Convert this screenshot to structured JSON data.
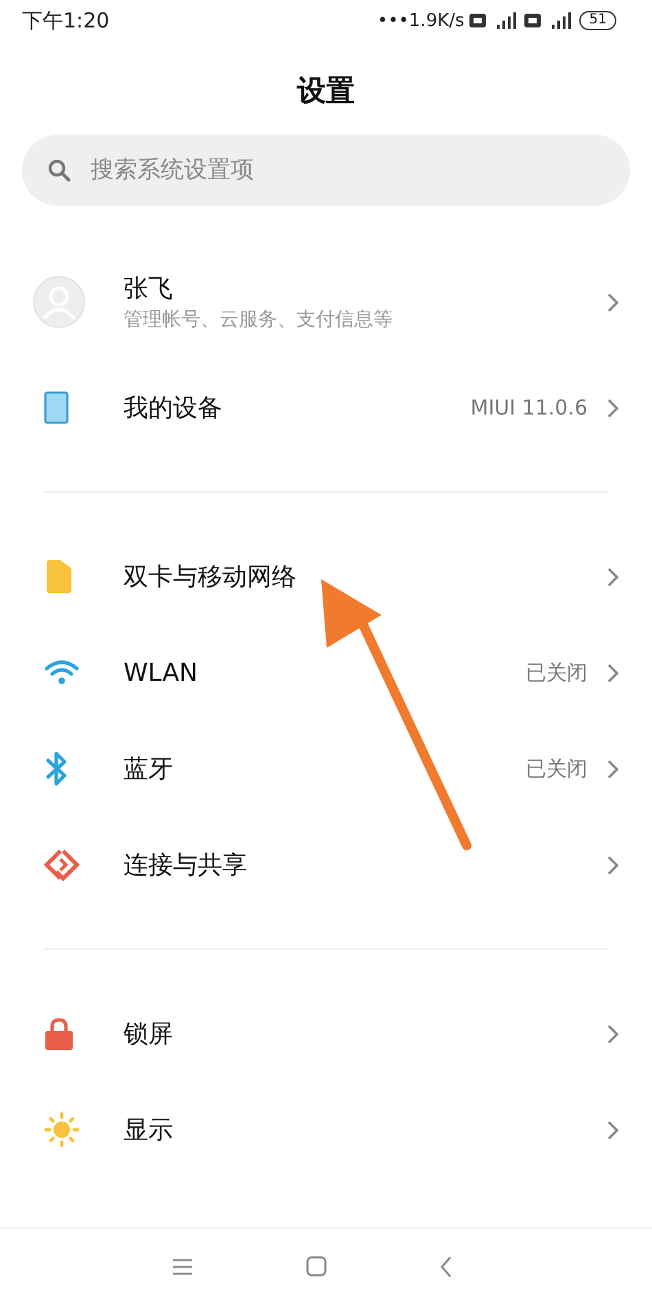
{
  "status_bar": {
    "time": "下午1:20",
    "speed": "•••1.9K/s",
    "battery": "51"
  },
  "title": "设置",
  "search": {
    "placeholder": "搜索系统设置项"
  },
  "sections": [
    {
      "rows": [
        {
          "kind": "profile",
          "label": "张飞",
          "subtitle": "管理帐号、云服务、支付信息等"
        },
        {
          "kind": "row",
          "label": "我的设备",
          "value": "MIUI 11.0.6"
        }
      ]
    },
    {
      "rows": [
        {
          "kind": "row",
          "label": "双卡与移动网络"
        },
        {
          "kind": "row",
          "label": "WLAN",
          "value": "已关闭"
        },
        {
          "kind": "row",
          "label": "蓝牙",
          "value": "已关闭"
        },
        {
          "kind": "row",
          "label": "连接与共享"
        }
      ]
    },
    {
      "rows": [
        {
          "kind": "row",
          "label": "锁屏"
        },
        {
          "kind": "row",
          "label": "显示"
        }
      ]
    }
  ]
}
